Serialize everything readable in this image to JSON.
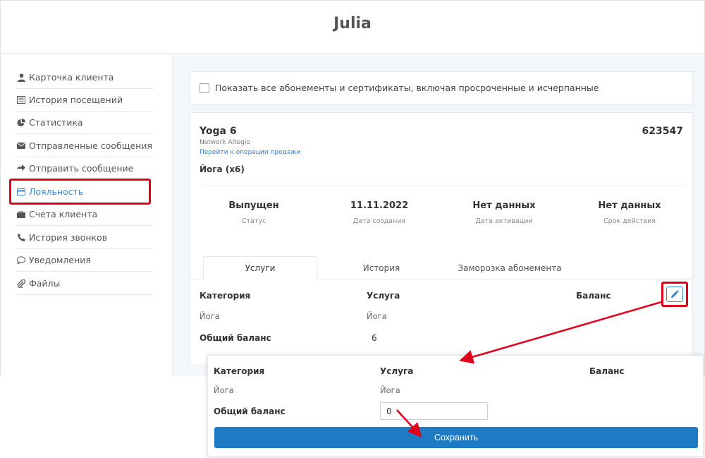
{
  "header": {
    "title": "Julia"
  },
  "sidebar": {
    "items": [
      {
        "label": "Карточка клиента",
        "icon": "user-icon"
      },
      {
        "label": "История посещений",
        "icon": "list-icon"
      },
      {
        "label": "Статистика",
        "icon": "pie-chart-icon"
      },
      {
        "label": "Отправленные сообщения",
        "icon": "envelope-icon"
      },
      {
        "label": "Отправить сообщение",
        "icon": "send-icon"
      },
      {
        "label": "Лояльность",
        "icon": "card-icon",
        "active": true
      },
      {
        "label": "Счета клиента",
        "icon": "briefcase-icon"
      },
      {
        "label": "История звонков",
        "icon": "phone-icon"
      },
      {
        "label": "Уведомления",
        "icon": "comment-icon"
      },
      {
        "label": "Файлы",
        "icon": "paperclip-icon"
      }
    ]
  },
  "filter": {
    "checkbox_label": "Показать все абонементы и сертификаты, включая просроченные и исчерпанные",
    "checked": false
  },
  "subscription": {
    "title": "Yoga 6",
    "number": "623547",
    "network": "Network Altegio",
    "sale_link": "Перейти к операции продажи",
    "name": "Йога (х6)",
    "stats": [
      {
        "value": "Выпущен",
        "label": "Статус"
      },
      {
        "value": "11.11.2022",
        "label": "Дата создания"
      },
      {
        "value": "Нет данных",
        "label": "Дата активации"
      },
      {
        "value": "Нет данных",
        "label": "Срок действия"
      }
    ],
    "tabs": [
      {
        "label": "Услуги",
        "active": true
      },
      {
        "label": "История"
      },
      {
        "label": "Заморозка абонемента"
      }
    ],
    "table": {
      "headers": {
        "category": "Категория",
        "service": "Услуга",
        "balance": "Баланс"
      },
      "row": {
        "category": "Йога",
        "service": "Йога"
      },
      "total_label": "Общий баланс",
      "total_value": "6"
    },
    "edit_icon": "pencil-icon"
  },
  "popup": {
    "headers": {
      "category": "Категория",
      "service": "Услуга",
      "balance": "Баланс"
    },
    "row": {
      "category": "Йога",
      "service": "Йога"
    },
    "total_label": "Общий баланс",
    "total_input_value": "0",
    "save_label": "Сохранить"
  },
  "colors": {
    "accent": "#1f7bc4",
    "link": "#2a7fd4",
    "highlight": "#e0001b",
    "background": "#f3f6fa"
  }
}
